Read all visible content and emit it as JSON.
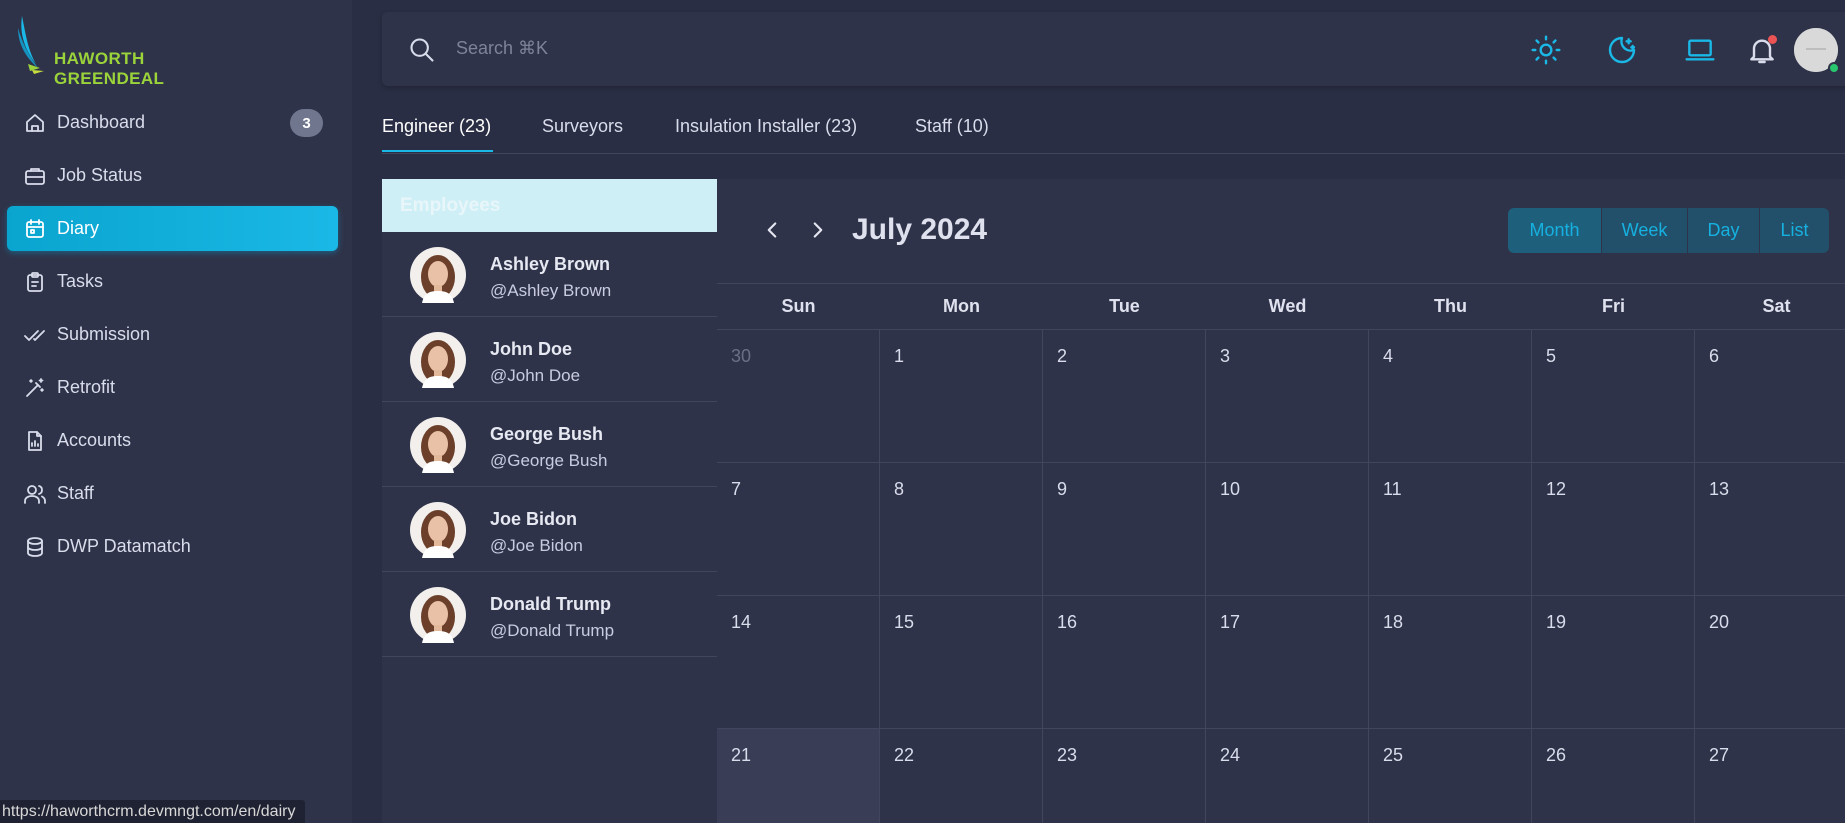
{
  "brand": {
    "name": "HAWORTH GREENDEAL"
  },
  "sidebar": {
    "items": [
      {
        "label": "Dashboard",
        "icon": "home-icon",
        "badge": "3"
      },
      {
        "label": "Job Status",
        "icon": "briefcase-icon"
      },
      {
        "label": "Diary",
        "icon": "calendar-icon",
        "active": true
      },
      {
        "label": "Tasks",
        "icon": "clipboard-icon"
      },
      {
        "label": "Submission",
        "icon": "double-check-icon"
      },
      {
        "label": "Retrofit",
        "icon": "magic-wand-icon"
      },
      {
        "label": "Accounts",
        "icon": "report-icon"
      },
      {
        "label": "Staff",
        "icon": "users-icon"
      },
      {
        "label": "DWP Datamatch",
        "icon": "database-icon"
      }
    ]
  },
  "status_url": "https://haworthcrm.devmngt.com/en/dairy",
  "search": {
    "placeholder": "Search ⌘K"
  },
  "topbar": {
    "icons": [
      "sun-icon",
      "moon-stars-icon",
      "laptop-icon",
      "bell-icon"
    ],
    "accent": "#1ab8e6"
  },
  "tabs": [
    {
      "label": "Engineer (23)",
      "active": true
    },
    {
      "label": "Surveyors"
    },
    {
      "label": "Insulation Installer (23)"
    },
    {
      "label": "Staff (10)"
    }
  ],
  "employees": {
    "header": "Employees",
    "list": [
      {
        "name": "Ashley Brown",
        "handle": "@Ashley Brown"
      },
      {
        "name": "John Doe",
        "handle": "@John Doe"
      },
      {
        "name": "George Bush",
        "handle": "@George Bush"
      },
      {
        "name": "Joe Bidon",
        "handle": "@Joe Bidon"
      },
      {
        "name": "Donald Trump",
        "handle": "@Donald Trump"
      }
    ]
  },
  "calendar": {
    "title": "July 2024",
    "views": [
      "Month",
      "Week",
      "Day",
      "List"
    ],
    "active_view": "Month",
    "days_of_week": [
      "Sun",
      "Mon",
      "Tue",
      "Wed",
      "Thu",
      "Fri",
      "Sat"
    ],
    "weeks": [
      [
        "30",
        "1",
        "2",
        "3",
        "4",
        "5",
        "6"
      ],
      [
        "7",
        "8",
        "9",
        "10",
        "11",
        "12",
        "13"
      ],
      [
        "14",
        "15",
        "16",
        "17",
        "18",
        "19",
        "20"
      ],
      [
        "21",
        "22",
        "23",
        "24",
        "25",
        "26",
        "27"
      ]
    ],
    "outside_month_days": [
      "30"
    ],
    "today": "21"
  }
}
